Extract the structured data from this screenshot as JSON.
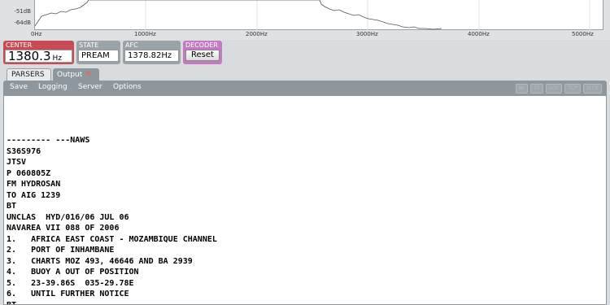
{
  "spectrum": {
    "db_labels": [
      "-51dB",
      "-64dB"
    ],
    "freq_labels": [
      "0Hz",
      "1000Hz",
      "2000Hz",
      "3000Hz",
      "4000Hz",
      "5000Hz"
    ]
  },
  "controls": {
    "center": {
      "label": "CENTER",
      "value": "1380.3",
      "unit": "Hz"
    },
    "state": {
      "label": "STATE",
      "value": "PREAM"
    },
    "afc": {
      "label": "AFC",
      "value": "1378.82Hz"
    },
    "decoder": {
      "label": "DECODER",
      "button": "Reset"
    }
  },
  "tabs": {
    "parsers": "PARSERS",
    "output": "Output"
  },
  "menu": [
    "Save",
    "Logging",
    "Server",
    "Options"
  ],
  "badges": [
    "BL",
    "TS",
    "LOG",
    "TCP",
    "SLCK"
  ],
  "output_lines": [
    "--------- ---NAWS",
    "S36S976",
    "JTSV",
    "P 060805Z",
    "FM HYDROSAN",
    "TO AIG 1239",
    "BT",
    "UNCLAS  HYD/016/06 JUL 06",
    "NAVAREA VII 088 OF 2006",
    "1.   AFRICA EAST COAST - MOZAMBIQUE CHANNEL",
    "2.   PORT OF INHAMBANE",
    "3.   CHARTS MOZ 493, 46646 AND BA 2939",
    "4.   BUOY A OUT OF POSITION",
    "5.   23-39.86S  035-29.78E",
    "6.   UNTIL FURTHER NOTICE",
    "BT"
  ]
}
